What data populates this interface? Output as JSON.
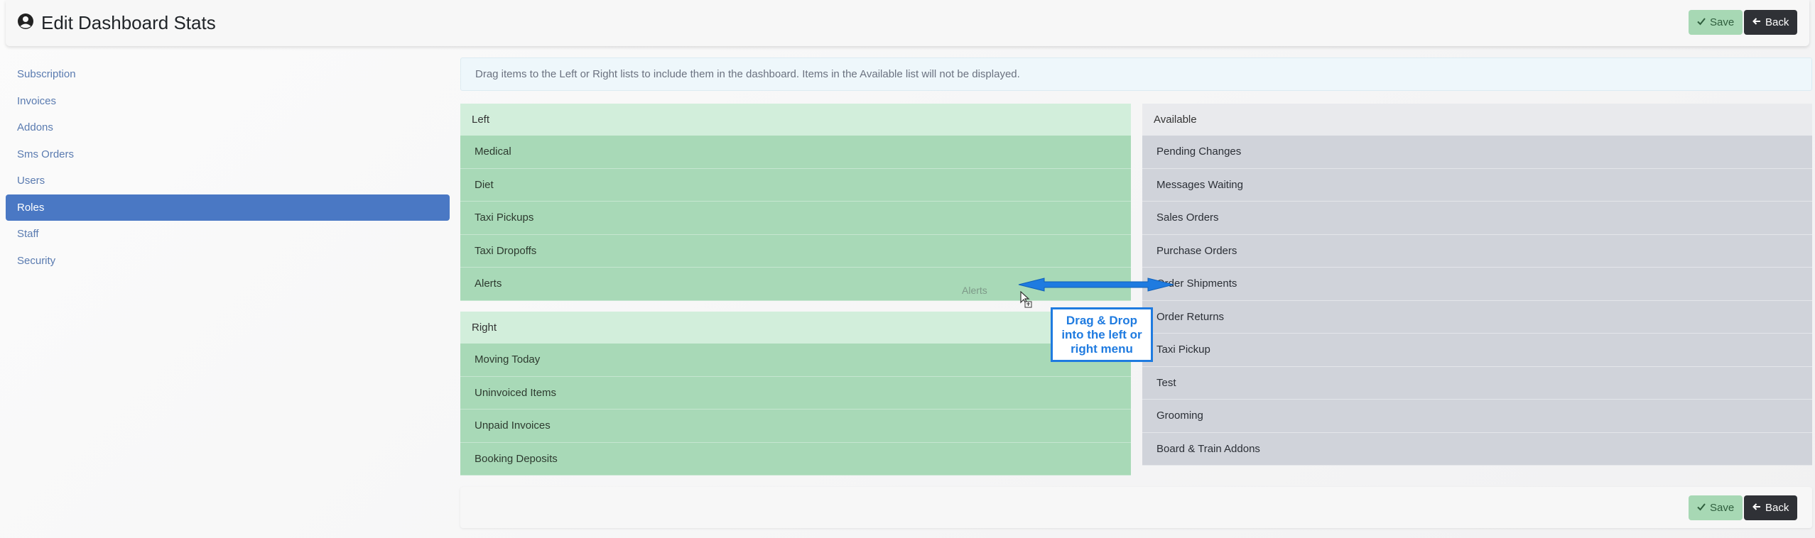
{
  "header": {
    "title": "Edit Dashboard Stats",
    "save_label": "Save",
    "back_label": "Back"
  },
  "sidebar": {
    "items": [
      {
        "label": "Subscription"
      },
      {
        "label": "Invoices"
      },
      {
        "label": "Addons"
      },
      {
        "label": "Sms Orders"
      },
      {
        "label": "Users"
      },
      {
        "label": "Roles"
      },
      {
        "label": "Staff"
      },
      {
        "label": "Security"
      }
    ],
    "active_index": 5
  },
  "info": {
    "text": "Drag items to the Left or Right lists to include them in the dashboard. Items in the Available list will not be displayed."
  },
  "left": {
    "title": "Left",
    "items": [
      "Medical",
      "Diet",
      "Taxi Pickups",
      "Taxi Dropoffs",
      "Alerts"
    ]
  },
  "right": {
    "title": "Right",
    "items": [
      "Moving Today",
      "Uninvoiced Items",
      "Unpaid Invoices",
      "Booking Deposits"
    ]
  },
  "available": {
    "title": "Available",
    "items": [
      "Pending Changes",
      "Messages Waiting",
      "Sales Orders",
      "Purchase Orders",
      "Order Shipments",
      "Order Returns",
      "Taxi Pickup",
      "Test",
      "Grooming",
      "Board & Train Addons"
    ]
  },
  "drag": {
    "ghost_label": "Alerts",
    "callout_lines": [
      "Drag & Drop",
      "into the left or",
      "right menu"
    ]
  },
  "footer": {
    "save_label": "Save",
    "back_label": "Back"
  },
  "colors": {
    "accent": "#4a78c4",
    "save_green": "#a7d8b4",
    "callout_blue": "#1f7be0"
  }
}
